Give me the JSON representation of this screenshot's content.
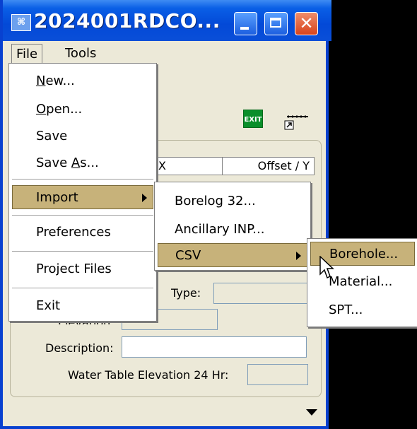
{
  "window": {
    "title": "2024001RDCO...",
    "app_icon": "app-icon"
  },
  "menubar": {
    "file": "File",
    "tools": "Tools"
  },
  "toolbar": {
    "exit_label": "EXIT"
  },
  "grid": {
    "col1": "X",
    "col2": "Offset / Y"
  },
  "form": {
    "type_label": "Type:",
    "elevation_label": "Elevation:",
    "description_label": "Description:",
    "water_table_label": "Water Table Elevation 24 Hr:"
  },
  "file_menu": {
    "new_pre": "",
    "new_ul": "N",
    "new_post": "ew...",
    "open_pre": "",
    "open_ul": "O",
    "open_post": "pen...",
    "save": "Save",
    "saveas_pre": "Save ",
    "saveas_ul": "A",
    "saveas_post": "s...",
    "import": "Import",
    "preferences": "Preferences",
    "project_files": "Project Files",
    "exit": "Exit"
  },
  "import_menu": {
    "borelog": "Borelog 32...",
    "ancillary": "Ancillary INP...",
    "csv": "CSV"
  },
  "csv_menu": {
    "borehole": "Borehole...",
    "material": "Material...",
    "spt": "SPT..."
  },
  "colors": {
    "title_bar": "#0a5fe6",
    "menu_highlight": "#c7b27a",
    "window_bg": "#ece9d8"
  }
}
